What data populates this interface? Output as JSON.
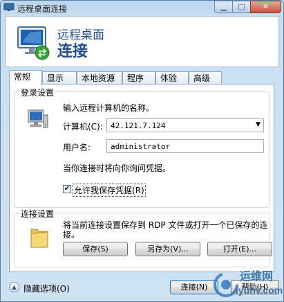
{
  "window": {
    "title": "远程桌面连接"
  },
  "banner": {
    "line1": "远程桌面",
    "line2": "连接"
  },
  "tabs": [
    {
      "label": "常规",
      "active": true
    },
    {
      "label": "显示"
    },
    {
      "label": "本地资源"
    },
    {
      "label": "程序"
    },
    {
      "label": "体验"
    },
    {
      "label": "高级"
    }
  ],
  "login": {
    "legend": "登录设置",
    "prompt": "输入远程计算机的名称。",
    "computer_label": "计算机(C):",
    "computer_value": "42.121.7.124",
    "user_label": "用户名:",
    "user_value": "administrator",
    "note": "当你连接时将向你询问凭据。",
    "save_checkbox_label": "允许我保存凭据(R)",
    "save_checkbox_checked": true
  },
  "connection": {
    "legend": "连接设置",
    "description_line1": "将当前连接设置保存到 RDP 文件或打开一个已保存的连",
    "description_line2": "接。",
    "save_button": "保存(S)",
    "save_as_button": "另存为(V)...",
    "open_button": "打开(E)..."
  },
  "footer": {
    "hide_options": "隐藏选项(O)",
    "connect_button": "连接(N)",
    "help_button": "帮助(H)"
  },
  "watermark": {
    "line1": "运维网",
    "line2": "iyunv.com"
  }
}
